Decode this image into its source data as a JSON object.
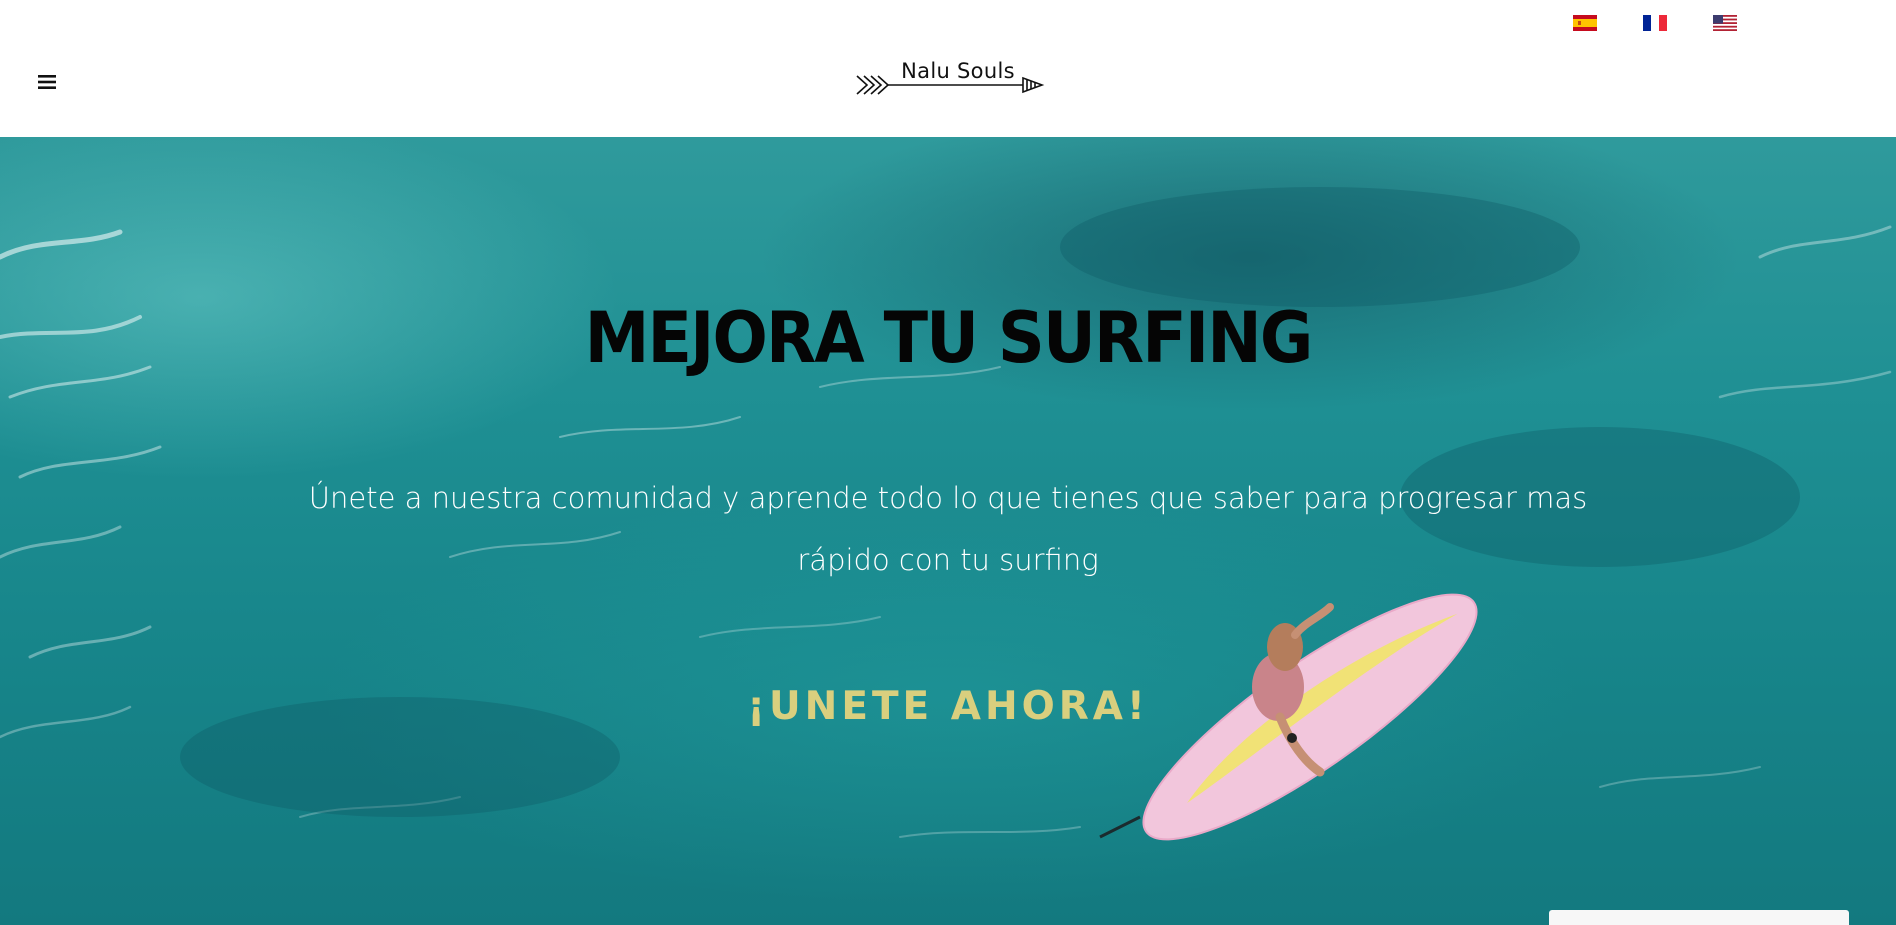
{
  "header": {
    "logo_text": "Nalu Souls",
    "languages": [
      {
        "code": "es",
        "icon": "spain-flag-icon"
      },
      {
        "code": "fr",
        "icon": "france-flag-icon"
      },
      {
        "code": "en",
        "icon": "usa-flag-icon"
      }
    ],
    "menu_icon": "hamburger-menu-icon"
  },
  "hero": {
    "title": "MEJORA TU SURFING",
    "subtitle": "Únete a nuestra comunidad y aprende todo lo que tienes que saber para progresar mas rápido con tu surfing",
    "cta": "¡UNETE AHORA!",
    "colors": {
      "water": "#1e8f93",
      "title": "#050505",
      "subtitle": "#ffffff",
      "cta": "#d9cf7e"
    }
  }
}
